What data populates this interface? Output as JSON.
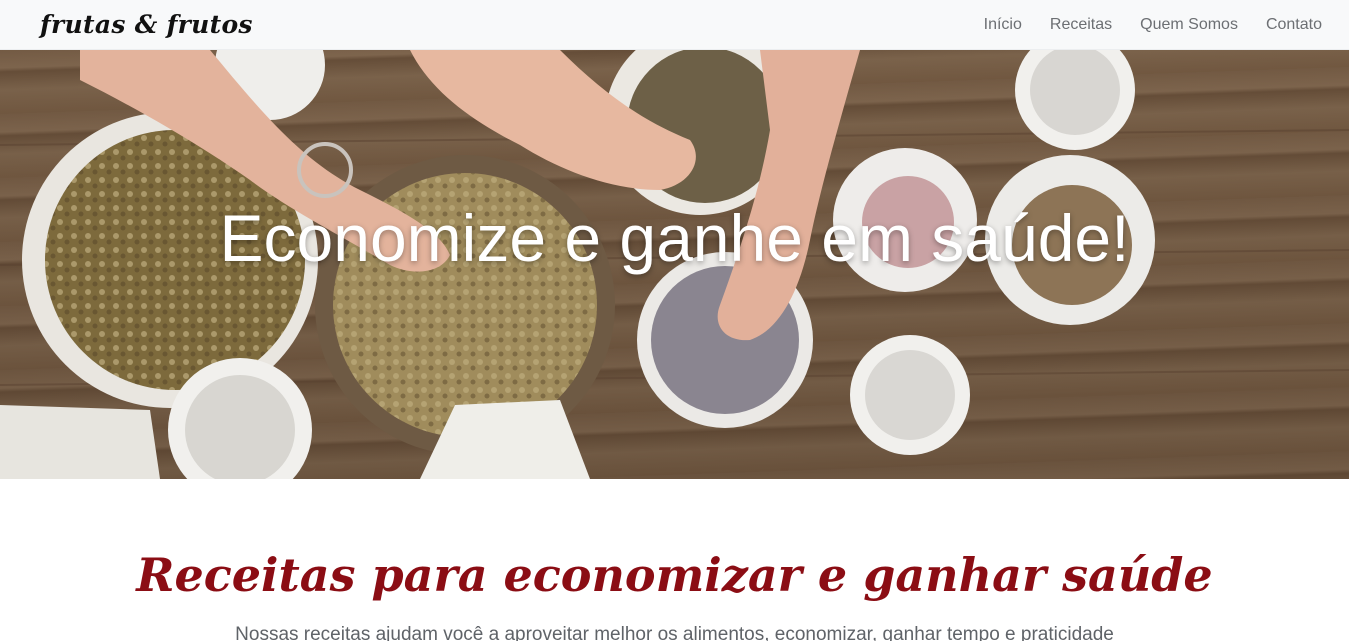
{
  "navbar": {
    "brand": "frutas & frutos",
    "links": [
      "Início",
      "Receitas",
      "Quem Somos",
      "Contato"
    ]
  },
  "hero": {
    "title": "Economize e ganhe em saúde!",
    "image_alt": "hands preparing herbs and seeds in bowls on a wooden table"
  },
  "recipes": {
    "heading": "Receitas para economizar e ganhar saúde",
    "text": "Nossas receitas ajudam você a aproveitar melhor os alimentos, economizar, ganhar tempo e praticidade"
  },
  "colors": {
    "navbar_bg": "#f8f9fa",
    "heading_accent": "#8b0d14",
    "nav_link": "#6c6f73"
  }
}
